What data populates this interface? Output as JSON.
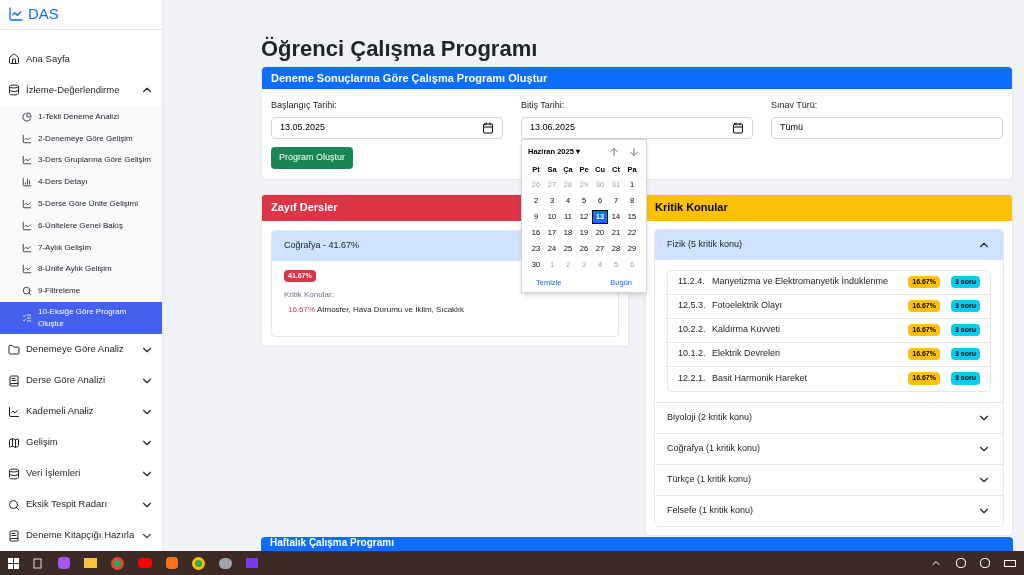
{
  "brand": "DAS",
  "sidebar": {
    "items": [
      {
        "label": "Ana Sayfa"
      },
      {
        "label": "İzleme-Değerlendirme",
        "expanded": true,
        "children": [
          {
            "label": "1-Tekli Deneme Analizi",
            "selected": false
          },
          {
            "label": "2-Denemeye Göre Gelişim",
            "selected": false
          },
          {
            "label": "3-Ders Gruplarına Göre Gelişim",
            "selected": false
          },
          {
            "label": "4-Ders Detayı",
            "selected": false
          },
          {
            "label": "5-Derse Göre Ünite Gelişimi",
            "selected": false
          },
          {
            "label": "6-Ünitelere Genel Bakış",
            "selected": false
          },
          {
            "label": "7-Aylık Gelişim",
            "selected": false
          },
          {
            "label": "8-Ünite Aylık Gelişim",
            "selected": false
          },
          {
            "label": "9-Filtreleme",
            "selected": false
          },
          {
            "label": "10-Eksiğe Göre Program Oluştur",
            "selected": true
          }
        ]
      },
      {
        "label": "Denemeye Göre Analiz",
        "expanded": false
      },
      {
        "label": "Derse Göre Analizi",
        "expanded": false
      },
      {
        "label": "Kademeli Analiz",
        "expanded": false
      },
      {
        "label": "Gelişim",
        "expanded": false
      },
      {
        "label": "Veri İşlemleri",
        "expanded": false
      },
      {
        "label": "Eksik Tespit Radarı",
        "expanded": false
      },
      {
        "label": "Deneme Kitapçığı Hazırla",
        "expanded": false
      }
    ]
  },
  "page_title": "Öğrenci Çalışma Programı",
  "form": {
    "title": "Deneme Sonuçlarına Göre Çalışma Programı Oluştur",
    "fields": [
      {
        "label": "Başlangıç Tarihi:",
        "value": "13.05.2025",
        "kind": "date"
      },
      {
        "label": "Bitiş Tarihi:",
        "value": "13.06.2025",
        "kind": "date"
      },
      {
        "label": "Sınav Türü:",
        "value": "Tümü",
        "kind": "select"
      }
    ],
    "button": "Program Oluştur"
  },
  "datepicker": {
    "month": "Haziran 2025",
    "month_caret": "▾",
    "weekdays": [
      "Pt",
      "Sa",
      "Ça",
      "Pe",
      "Cu",
      "Ct",
      "Pa"
    ],
    "weeks": [
      [
        {
          "d": "26",
          "muted": true,
          "selected": false
        },
        {
          "d": "27",
          "muted": true,
          "selected": false
        },
        {
          "d": "28",
          "muted": true,
          "selected": false
        },
        {
          "d": "29",
          "muted": true,
          "selected": false
        },
        {
          "d": "30",
          "muted": true,
          "selected": false
        },
        {
          "d": "31",
          "muted": true,
          "selected": false
        },
        {
          "d": "1",
          "muted": false,
          "selected": false
        }
      ],
      [
        {
          "d": "2",
          "muted": false,
          "selected": false
        },
        {
          "d": "3",
          "muted": false,
          "selected": false
        },
        {
          "d": "4",
          "muted": false,
          "selected": false
        },
        {
          "d": "5",
          "muted": false,
          "selected": false
        },
        {
          "d": "6",
          "muted": false,
          "selected": false
        },
        {
          "d": "7",
          "muted": false,
          "selected": false
        },
        {
          "d": "8",
          "muted": false,
          "selected": false
        }
      ],
      [
        {
          "d": "9",
          "muted": false,
          "selected": false
        },
        {
          "d": "10",
          "muted": false,
          "selected": false
        },
        {
          "d": "11",
          "muted": false,
          "selected": false
        },
        {
          "d": "12",
          "muted": false,
          "selected": false
        },
        {
          "d": "13",
          "muted": false,
          "selected": true
        },
        {
          "d": "14",
          "muted": false,
          "selected": false
        },
        {
          "d": "15",
          "muted": false,
          "selected": false
        }
      ],
      [
        {
          "d": "16",
          "muted": false,
          "selected": false
        },
        {
          "d": "17",
          "muted": false,
          "selected": false
        },
        {
          "d": "18",
          "muted": false,
          "selected": false
        },
        {
          "d": "19",
          "muted": false,
          "selected": false
        },
        {
          "d": "20",
          "muted": false,
          "selected": false
        },
        {
          "d": "21",
          "muted": false,
          "selected": false
        },
        {
          "d": "22",
          "muted": false,
          "selected": false
        }
      ],
      [
        {
          "d": "23",
          "muted": false,
          "selected": false
        },
        {
          "d": "24",
          "muted": false,
          "selected": false
        },
        {
          "d": "25",
          "muted": false,
          "selected": false
        },
        {
          "d": "26",
          "muted": false,
          "selected": false
        },
        {
          "d": "27",
          "muted": false,
          "selected": false
        },
        {
          "d": "28",
          "muted": false,
          "selected": false
        },
        {
          "d": "29",
          "muted": false,
          "selected": false
        }
      ],
      [
        {
          "d": "30",
          "muted": false,
          "selected": false
        },
        {
          "d": "1",
          "muted": true,
          "selected": false
        },
        {
          "d": "2",
          "muted": true,
          "selected": false
        },
        {
          "d": "3",
          "muted": true,
          "selected": false
        },
        {
          "d": "4",
          "muted": true,
          "selected": false
        },
        {
          "d": "5",
          "muted": true,
          "selected": false
        },
        {
          "d": "6",
          "muted": true,
          "selected": false
        }
      ]
    ],
    "clear": "Temizle",
    "today": "Bugün"
  },
  "weak": {
    "title": "Zayıf Dersler",
    "items": [
      {
        "header": "Coğrafya - 41.67%",
        "badge": "41.67%",
        "topics_label": "Kritik Konular:",
        "topics": [
          {
            "percent": "16.67%",
            "text": "Atmosfer, Hava Durumu ve İklim, Sıcaklık"
          }
        ]
      }
    ]
  },
  "critical": {
    "title": "Kritik Konular",
    "groups": [
      {
        "title": "Fizik (5 kritik konu)",
        "expanded": true,
        "topics": [
          {
            "code": "11.2.4.",
            "name": "Manyetizma ve Elektromanyetik İndüklenme",
            "percent": "16.67%",
            "count": "3 soru"
          },
          {
            "code": "12.5.3.",
            "name": "Fotoelektrik Olayı",
            "percent": "16.67%",
            "count": "3 soru"
          },
          {
            "code": "10.2.2.",
            "name": "Kaldırma Kuvveti",
            "percent": "16.67%",
            "count": "3 soru"
          },
          {
            "code": "10.1.2.",
            "name": "Elektrik Devreleri",
            "percent": "16.67%",
            "count": "3 soru"
          },
          {
            "code": "12.2.1.",
            "name": "Basit Harmonik Hareket",
            "percent": "16.67%",
            "count": "3 soru"
          }
        ]
      },
      {
        "title": "Biyoloji (2 kritik konu)",
        "expanded": false
      },
      {
        "title": "Coğrafya (1 kritik konu)",
        "expanded": false
      },
      {
        "title": "Türkçe (1 kritik konu)",
        "expanded": false
      },
      {
        "title": "Felsefe (1 kritik konu)",
        "expanded": false
      }
    ]
  },
  "weekly": {
    "title": "Haftalık Çalışma Programı"
  }
}
